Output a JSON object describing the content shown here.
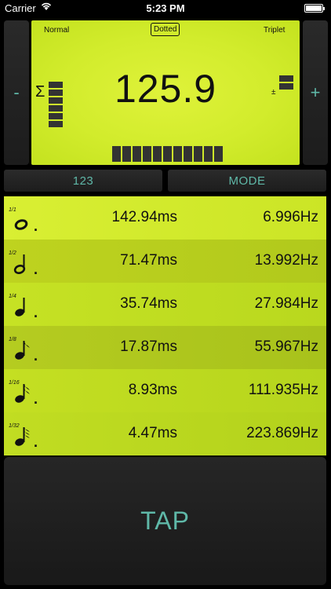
{
  "status_bar": {
    "carrier": "Carrier",
    "time": "5:23 PM"
  },
  "controls": {
    "minus_label": "-",
    "plus_label": "+",
    "numbers_label": "123",
    "mode_label": "MODE",
    "tap_label": "TAP"
  },
  "display": {
    "normal_label": "Normal",
    "dotted_label": "Dotted",
    "triplet_label": "Triplet",
    "bpm": "125.9",
    "sigma_symbol": "Σ",
    "plusminus_symbol": "±",
    "accent_color": "#5fb8a8",
    "lcd_color": "#d2ec2c"
  },
  "rows": [
    {
      "fraction": "1/1",
      "note_icon": "whole-note-icon",
      "dotted": ".",
      "ms": "142.94ms",
      "hz": "6.996Hz"
    },
    {
      "fraction": "1/2",
      "note_icon": "half-note-icon",
      "dotted": ".",
      "ms": "71.47ms",
      "hz": "13.992Hz"
    },
    {
      "fraction": "1/4",
      "note_icon": "quarter-note-icon",
      "dotted": ".",
      "ms": "35.74ms",
      "hz": "27.984Hz"
    },
    {
      "fraction": "1/8",
      "note_icon": "eighth-note-icon",
      "dotted": ".",
      "ms": "17.87ms",
      "hz": "55.967Hz"
    },
    {
      "fraction": "1/16",
      "note_icon": "sixteenth-note-icon",
      "dotted": ".",
      "ms": "8.93ms",
      "hz": "111.935Hz"
    },
    {
      "fraction": "1/32",
      "note_icon": "thirtysecond-note-icon",
      "dotted": ".",
      "ms": "4.47ms",
      "hz": "223.869Hz"
    }
  ]
}
